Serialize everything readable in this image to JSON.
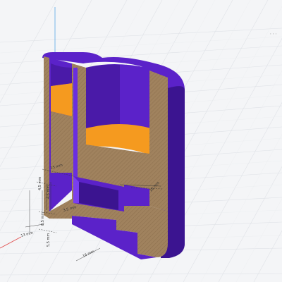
{
  "colors": {
    "background": "#f4f5f7",
    "grid": "#d9dce2",
    "grid_major": "#c9cdd4",
    "section_face": "#a0825e",
    "body": "#5b22c9",
    "body_dark": "#3b1490",
    "body_light": "#7a3ef0",
    "fill_surface": "#f59a1f",
    "axis_z": "#5aa7e6",
    "axis_x": "#e04b4b"
  },
  "icons": {
    "menu": "more-dots-icon"
  },
  "viewport": {
    "menu_glyph": "···"
  },
  "dimensions": {
    "d1": "15 mm",
    "d2": "4,5 mm",
    "d3": "4,5 mm",
    "d4": "3,5 mm",
    "d5": "8,5 mm",
    "d6": "13 mm",
    "d7": "5,5 mm",
    "d8": "16 mm",
    "d9": "16 mm"
  }
}
